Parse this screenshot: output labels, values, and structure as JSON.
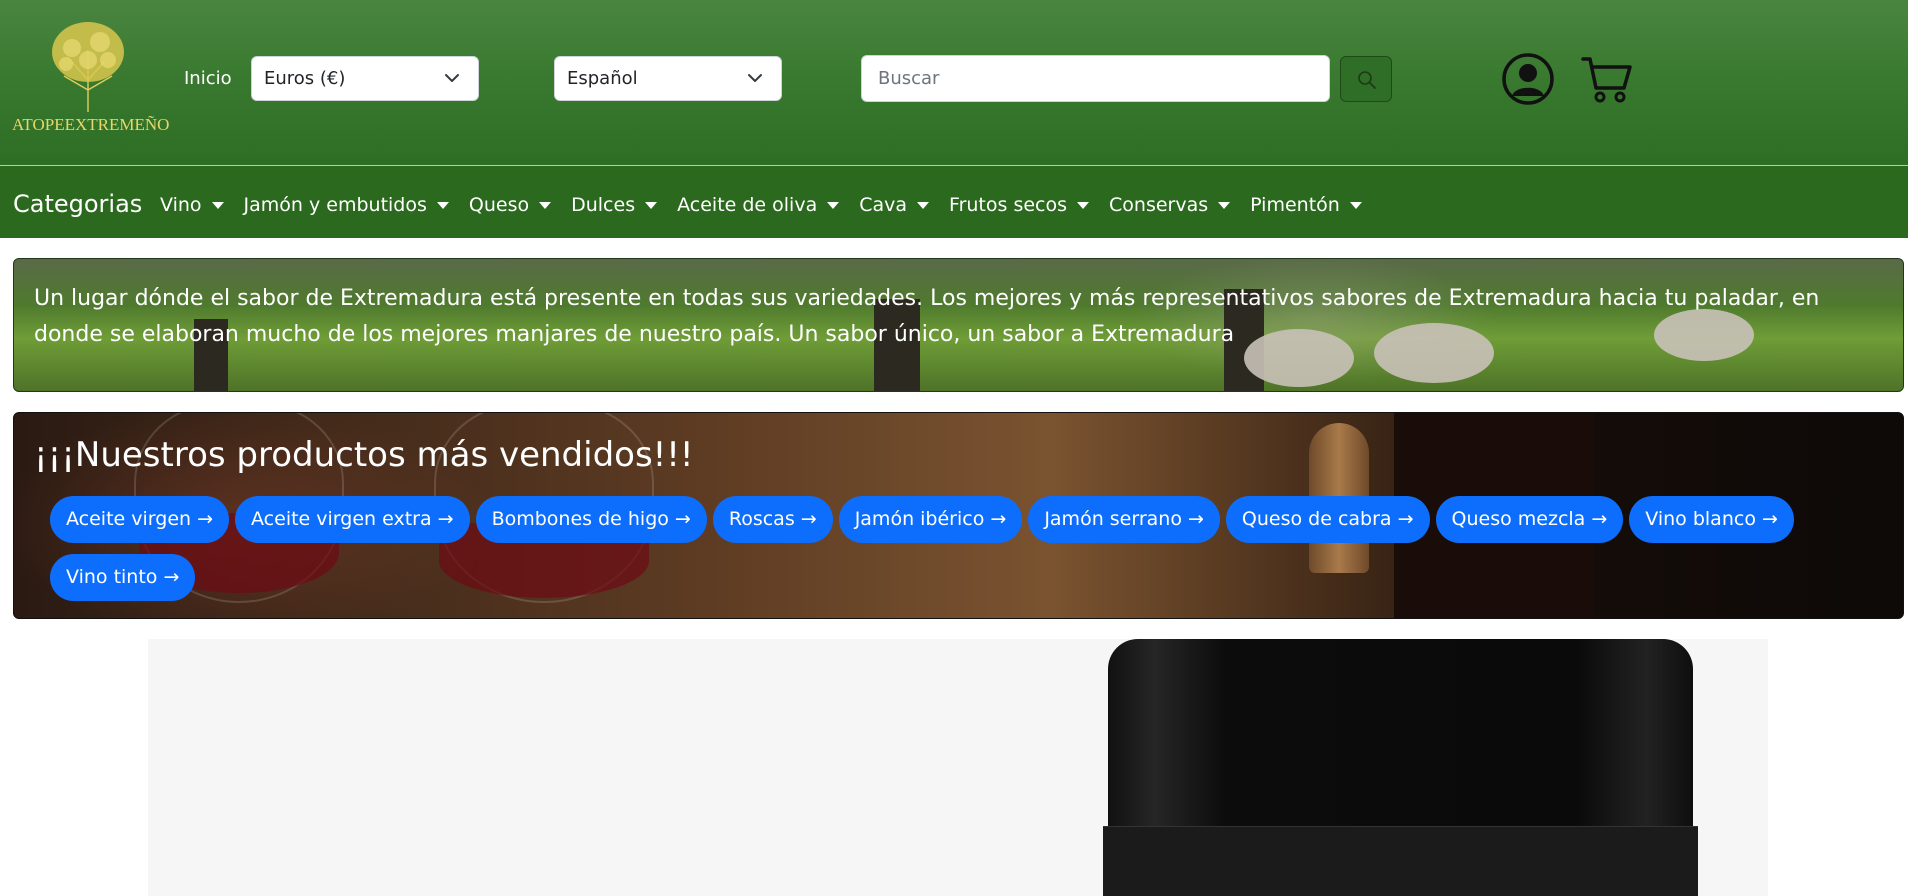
{
  "header": {
    "logo_text": "ATOPEEXTREMEÑO",
    "nav_home": "Inicio",
    "currency_select": "Euros (€)",
    "language_select": "Español",
    "search_placeholder": "Buscar",
    "icons": [
      "search-icon",
      "user-icon",
      "cart-icon"
    ]
  },
  "categories": {
    "title": "Categorias",
    "items": [
      {
        "label": "Vino"
      },
      {
        "label": "Jamón y embutidos"
      },
      {
        "label": "Queso"
      },
      {
        "label": "Dulces"
      },
      {
        "label": "Aceite de oliva"
      },
      {
        "label": "Cava"
      },
      {
        "label": "Frutos secos"
      },
      {
        "label": "Conservas"
      },
      {
        "label": "Pimentón"
      }
    ]
  },
  "banner": {
    "text": "Un lugar dónde el sabor de Extremadura está presente en todas sus variedades. Los mejores y más representativos sabores de Extremadura hacia tu paladar, en donde se elaboran mucho de los mejores manjares de nuestro país. Un sabor único, un sabor a Extremadura"
  },
  "bestsellers": {
    "title": "¡¡¡Nuestros productos más vendidos!!!",
    "products": [
      {
        "label": "Aceite virgen →"
      },
      {
        "label": "Aceite virgen extra →"
      },
      {
        "label": "Bombones de higo →"
      },
      {
        "label": "Roscas →"
      },
      {
        "label": "Jamón ibérico →"
      },
      {
        "label": "Jamón serrano →"
      },
      {
        "label": "Queso de cabra →"
      },
      {
        "label": "Queso mezcla →"
      },
      {
        "label": "Vino blanco →"
      },
      {
        "label": "Vino tinto →"
      }
    ]
  },
  "colors": {
    "header_green": "#3a7a30",
    "nav_green": "#2b6a1e",
    "logo_gold": "#e7d66a",
    "button_blue": "#0d6efd"
  }
}
